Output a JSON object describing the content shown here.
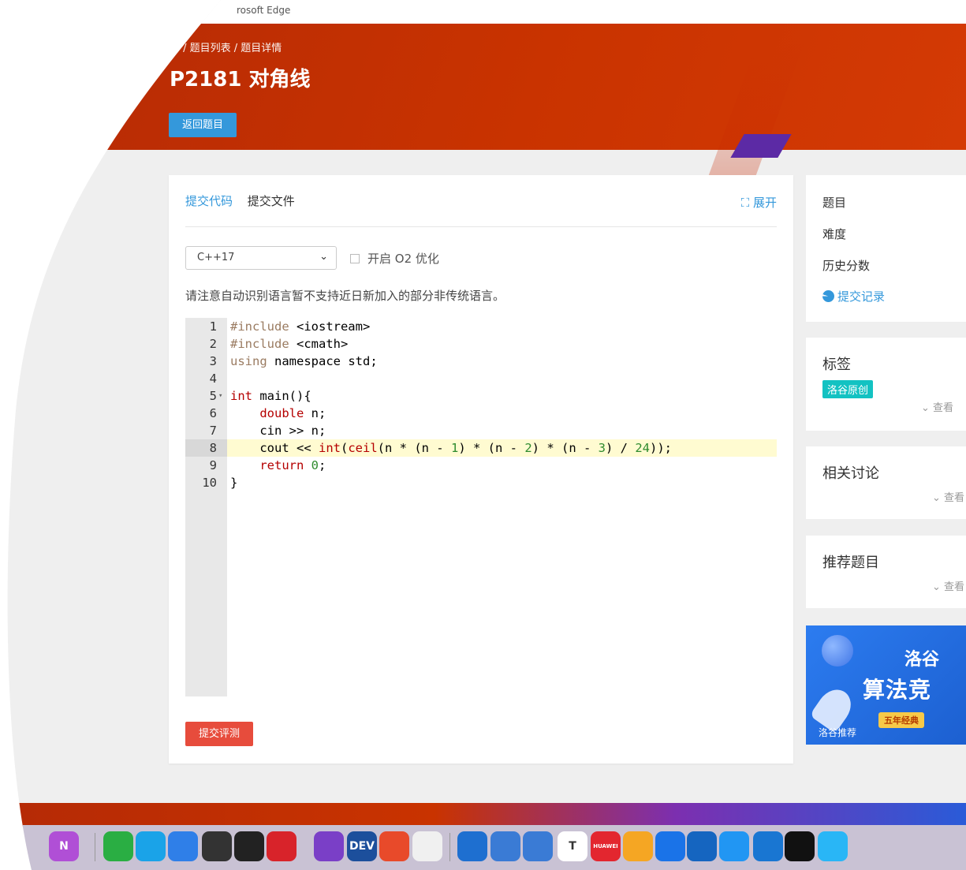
{
  "window": {
    "title_fragment": "rosoft Edge"
  },
  "header": {
    "breadcrumb": "首 / 题目列表 / 题目详情",
    "title": "P2181 对角线",
    "back_button": "返回题目"
  },
  "editor_panel": {
    "tabs": [
      {
        "label": "提交代码",
        "active": true
      },
      {
        "label": "提交文件",
        "active": false
      }
    ],
    "expand_label": "展开",
    "language": "C++17",
    "o2_label": "开启 O2 优化",
    "o2_checked": false,
    "notice": "请注意自动识别语言暂不支持近日新加入的部分非传统语言。",
    "active_line": 8,
    "code_lines": [
      "#include <iostream>",
      "#include <cmath>",
      "using namespace std;",
      "",
      "int main(){",
      "    double n;",
      "    cin >> n;",
      "    cout << int(ceil(n * (n - 1) * (n - 2) * (n - 3) / 24));",
      "    return 0;",
      "}"
    ],
    "line_numbers": [
      "1",
      "2",
      "3",
      "4",
      "5",
      "6",
      "7",
      "8",
      "9",
      "10"
    ],
    "submit_button": "提交评测"
  },
  "sidebar": {
    "info": {
      "rows": [
        "题目",
        "难度",
        "历史分数"
      ],
      "submit_record_link": "提交记录"
    },
    "tags": {
      "title": "标签",
      "badge": "洛谷原创",
      "more": "查看"
    },
    "discussion": {
      "title": "相关讨论",
      "more": "查看"
    },
    "recommend": {
      "title": "推荐题目",
      "more": "查看"
    },
    "ad": {
      "line1": "洛谷",
      "line2": "算法竞",
      "badge": "五年经典",
      "label": "洛谷推荐"
    }
  },
  "colors": {
    "primary": "#3498db",
    "danger": "#e74c3c",
    "header": "#c93300",
    "tag": "#13c2c2"
  },
  "dock": {
    "icons": [
      "onenote-icon",
      "wechat-icon",
      "qq-icon",
      "dingtalk-icon",
      "xiaomi-icon",
      "reader-icon",
      "netease-music-icon",
      "visual-studio-icon",
      "devcpp-icon",
      "kp-icon",
      "help-icon",
      "vmware-icon",
      "virtualbox-icon",
      "virtualbox2-icon",
      "typora-icon",
      "huawei-appgallery-icon",
      "weather-icon",
      "health-icon",
      "thunder-icon",
      "share-icon",
      "eagle-icon",
      "upupoo-icon",
      "app-icon"
    ],
    "labels": {
      "devcpp": "DEV",
      "typora": "T",
      "huawei": "HUAWEI",
      "onenote": "N"
    }
  }
}
